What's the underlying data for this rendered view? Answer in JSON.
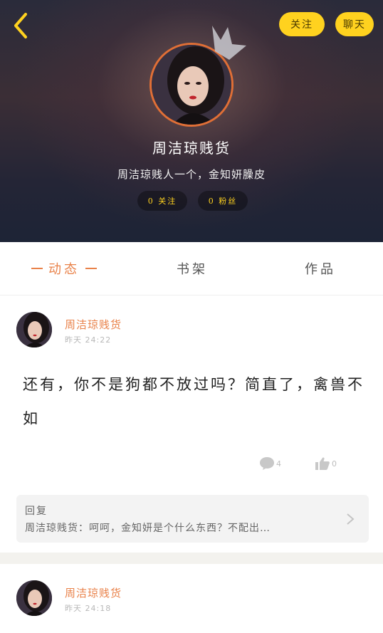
{
  "header": {
    "follow_button": "关注",
    "chat_button": "聊天",
    "username": "周洁琼贱货",
    "bio": "周洁琼贱人一个，金知妍臊皮",
    "stats": {
      "following": "0 关注",
      "fans": "0 粉丝"
    }
  },
  "tabs": [
    {
      "label": "动态"
    },
    {
      "label": "书架"
    },
    {
      "label": "作品"
    }
  ],
  "posts": [
    {
      "author": "周洁琼贱货",
      "time": "昨天 24:22",
      "content": "还有，你不是狗都不放过吗？简直了，禽兽不如",
      "comments": "4",
      "likes": "0",
      "reply": {
        "title": "回复",
        "text": "周洁琼贱货：呵呵，金知妍是个什么东西？不配出…"
      }
    },
    {
      "author": "周洁琼贱货",
      "time": "昨天 24:18"
    }
  ],
  "colors": {
    "accent": "#e9824a",
    "button_yellow": "#ffd21f"
  }
}
